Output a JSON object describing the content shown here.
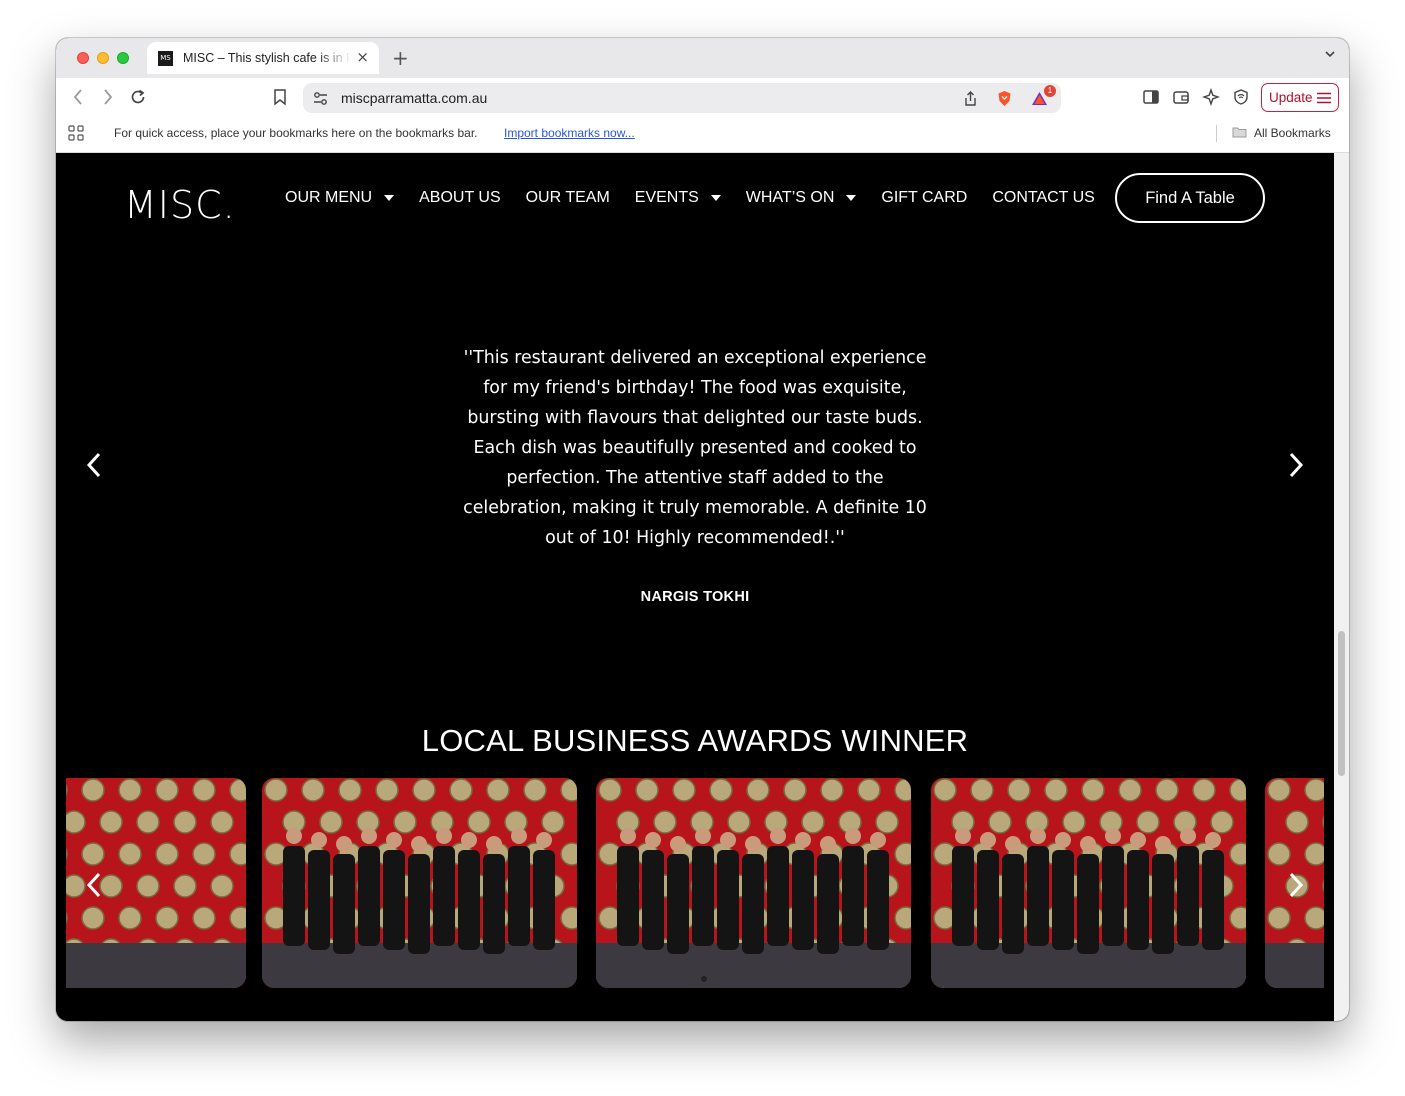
{
  "browser": {
    "tab_title": "MISC – This stylish cafe is in Parramatta",
    "tab_favicon": "MS",
    "url": "miscparramatta.com.au",
    "update_label": "Update",
    "notification_count": "1",
    "bookmarks_hint": "For quick access, place your bookmarks here on the bookmarks bar.",
    "bookmarks_import_link": "Import bookmarks now...",
    "all_bookmarks_label": "All Bookmarks"
  },
  "site": {
    "logo": "MISC.",
    "nav": [
      {
        "label": "OUR MENU",
        "dropdown": true
      },
      {
        "label": "ABOUT US",
        "dropdown": false
      },
      {
        "label": "OUR TEAM",
        "dropdown": false
      },
      {
        "label": "EVENTS",
        "dropdown": true
      },
      {
        "label": "WHAT’S ON",
        "dropdown": true
      },
      {
        "label": "GIFT CARD",
        "dropdown": false
      },
      {
        "label": "CONTACT US",
        "dropdown": false
      }
    ],
    "cta_label": "Find A Table"
  },
  "testimonial": {
    "quote": "''This restaurant delivered an exceptional experience for my friend's birthday! The food was exquisite, bursting with flavours that delighted our taste buds. Each dish was beautifully presented and cooked to perfection. The attentive staff added to the celebration, making it truly memorable. A definite 10 out of 10! Highly recommended!.''",
    "author": "NARGIS TOKHI"
  },
  "awards": {
    "title": "LOCAL BUSINESS AWARDS WINNER",
    "slides": [
      {
        "name": "award-photo-partial-left"
      },
      {
        "name": "award-photo-team-1"
      },
      {
        "name": "award-photo-team-2"
      },
      {
        "name": "award-photo-team-3"
      },
      {
        "name": "award-photo-partial-right"
      }
    ]
  },
  "colors": {
    "page_bg": "#000000",
    "text": "#ffffff",
    "award_backdrop": "#b8141c",
    "update_red": "#c4213d",
    "link_blue": "#2a55d6"
  }
}
